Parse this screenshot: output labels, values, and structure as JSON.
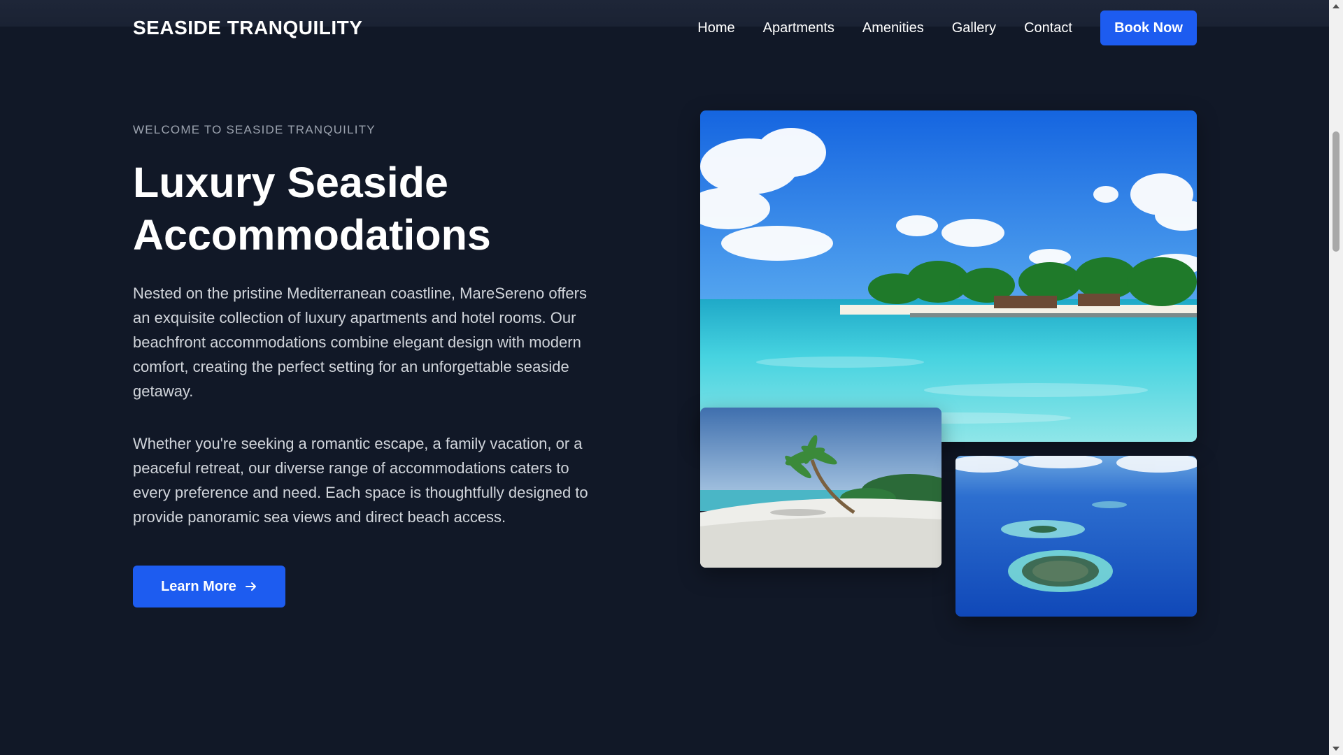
{
  "header": {
    "logo": "SEASIDE TRANQUILITY",
    "nav": [
      "Home",
      "Apartments",
      "Amenities",
      "Gallery",
      "Contact"
    ],
    "book_label": "Book Now"
  },
  "hero": {
    "eyebrow": "WELCOME TO SEASIDE TRANQUILITY",
    "title_line1": "Luxury Seaside",
    "title_line2": "Accommodations",
    "paragraph1": "Nested on the pristine Mediterranean coastline, MareSereno offers an exquisite collection of luxury apartments and hotel rooms. Our beachfront accommodations combine elegant design with modern comfort, creating the perfect setting for an unforgettable seaside getaway.",
    "paragraph2": "Whether you're seeking a romantic escape, a family vacation, or a peaceful retreat, our diverse range of accommodations caters to every preference and need. Each space is thoughtfully designed to provide panoramic sea views and direct beach access.",
    "cta_label": "Learn More",
    "cta_icon": "arrow-right-icon"
  },
  "gallery": {
    "images": [
      "tropical-beach-resort-photo",
      "palm-tree-beach-photo",
      "atoll-aerial-photo"
    ]
  },
  "colors": {
    "background": "#111827",
    "accent": "#1d5cf0",
    "muted_text": "#9ca3af",
    "body_text": "#d1d5db"
  }
}
